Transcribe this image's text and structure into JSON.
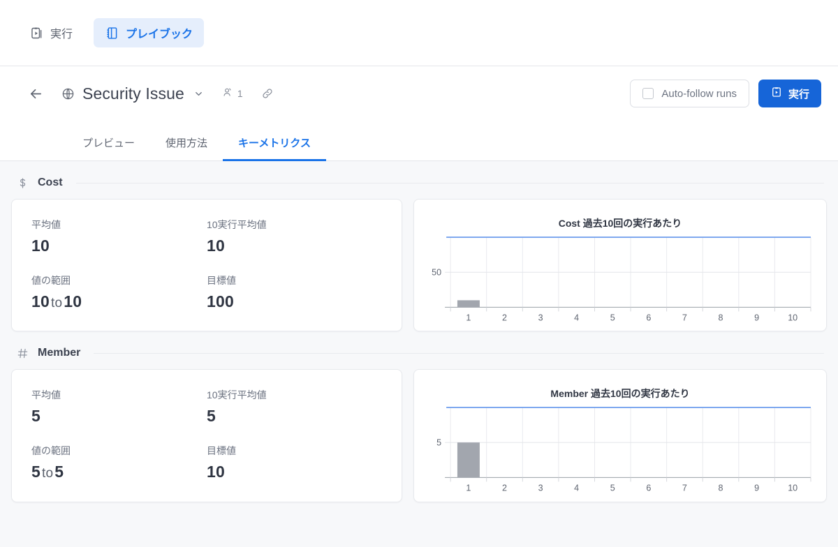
{
  "toolbar": {
    "items": [
      {
        "label": "実行",
        "icon": "clipboard-play-icon",
        "active": false
      },
      {
        "label": "プレイブック",
        "icon": "notebook-icon",
        "active": true
      }
    ]
  },
  "header": {
    "back_icon": "arrow-left-icon",
    "scope_icon": "globe-icon",
    "title": "Security Issue",
    "caret_icon": "chevron-down-icon",
    "members_icon": "user-badge-icon",
    "members_count": "1",
    "link_icon": "link-icon",
    "auto_follow_label": "Auto-follow runs",
    "auto_follow_checked": false,
    "run_label": "実行",
    "run_icon": "clipboard-play-icon",
    "accent_color": "#1a73e8",
    "run_button_color": "#1665d8"
  },
  "tabs": [
    {
      "label": "プレビュー",
      "active": false
    },
    {
      "label": "使用方法",
      "active": false
    },
    {
      "label": "キーメトリクス",
      "active": true
    }
  ],
  "sections": [
    {
      "icon": "dollar-icon",
      "title": "Cost",
      "stats": [
        {
          "label": "平均値",
          "value": "10"
        },
        {
          "label": "10実行平均値",
          "value": "10"
        },
        {
          "label": "値の範囲",
          "value_from": "10",
          "value_join": "to",
          "value_to": "10"
        },
        {
          "label": "目標値",
          "value": "100"
        }
      ]
    },
    {
      "icon": "hash-icon",
      "title": "Member",
      "stats": [
        {
          "label": "平均値",
          "value": "5"
        },
        {
          "label": "10実行平均値",
          "value": "5"
        },
        {
          "label": "値の範囲",
          "value_from": "5",
          "value_join": "to",
          "value_to": "5"
        },
        {
          "label": "目標値",
          "value": "10"
        }
      ]
    }
  ],
  "chart_data": [
    {
      "type": "bar",
      "title": "Cost 過去10回の実行あたり",
      "categories": [
        "1",
        "2",
        "3",
        "4",
        "5",
        "6",
        "7",
        "8",
        "9",
        "10"
      ],
      "values": [
        10,
        null,
        null,
        null,
        null,
        null,
        null,
        null,
        null,
        null
      ],
      "ytick_labels": [
        "50"
      ],
      "yticks": [
        50
      ],
      "ylim": [
        0,
        100
      ],
      "target_line": 100,
      "target_color": "#6c9ced",
      "bar_color": "#a2a6ae",
      "grid": true,
      "xlabel": "",
      "ylabel": ""
    },
    {
      "type": "bar",
      "title": "Member 過去10回の実行あたり",
      "categories": [
        "1",
        "2",
        "3",
        "4",
        "5",
        "6",
        "7",
        "8",
        "9",
        "10"
      ],
      "values": [
        5,
        null,
        null,
        null,
        null,
        null,
        null,
        null,
        null,
        null
      ],
      "ytick_labels": [
        "5"
      ],
      "yticks": [
        5
      ],
      "ylim": [
        0,
        10
      ],
      "target_line": 10,
      "target_color": "#6c9ced",
      "bar_color": "#a2a6ae",
      "grid": true,
      "xlabel": "",
      "ylabel": ""
    }
  ]
}
